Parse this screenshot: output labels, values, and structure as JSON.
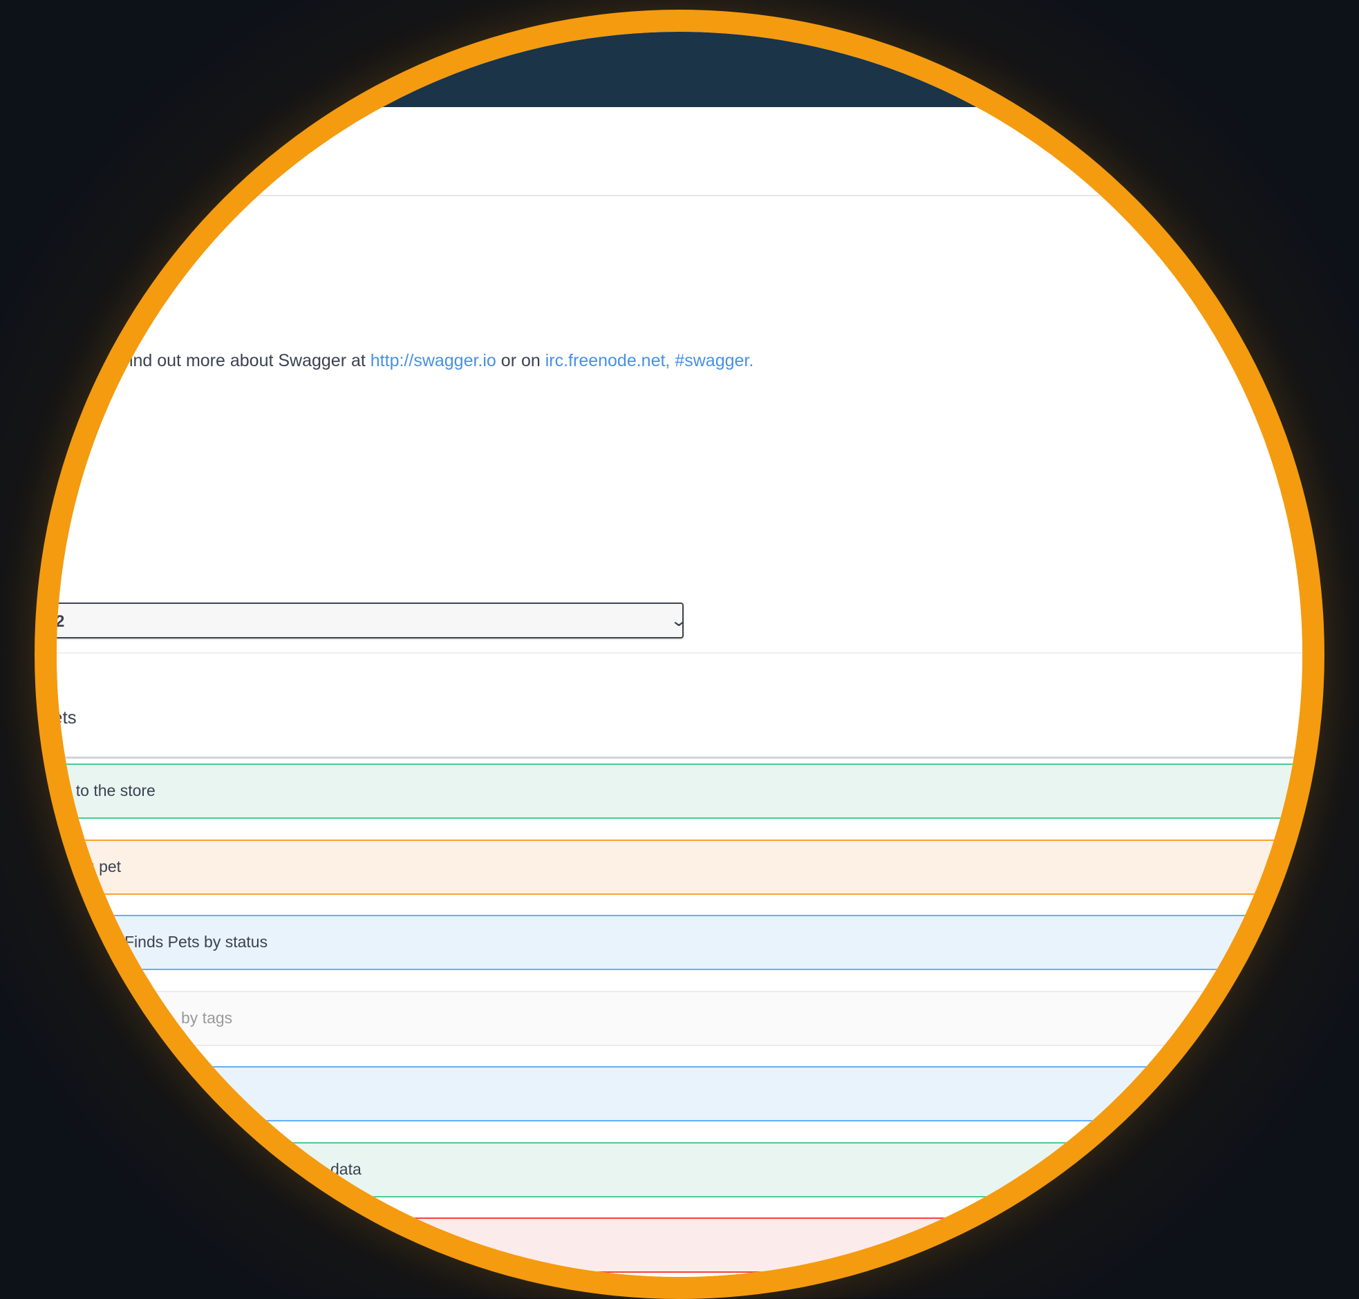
{
  "info": {
    "description_prefix": "find out more about Swagger at ",
    "link_swagger": "http://swagger.io",
    "description_middle": " or on ",
    "link_irc": "irc.freenode.net, #swagger."
  },
  "servers": {
    "selected": "2"
  },
  "tag": {
    "name": "ets"
  },
  "operations": [
    {
      "method": "post",
      "summary": "t to the store"
    },
    {
      "method": "put",
      "summary": "ing pet"
    },
    {
      "method": "get",
      "summary": "Finds Pets by status"
    },
    {
      "method": "get",
      "deprecated": true,
      "summary": "by tags"
    },
    {
      "method": "get",
      "summary": ""
    },
    {
      "method": "post",
      "summary": "data"
    },
    {
      "method": "delete",
      "summary": ""
    }
  ],
  "colors": {
    "lens_ring": "#f59b0f",
    "topbar": "#1b3447",
    "link": "#4990e2",
    "post": "#49cc90",
    "put": "#fca130",
    "get": "#61affe",
    "delete": "#f93e3e"
  }
}
